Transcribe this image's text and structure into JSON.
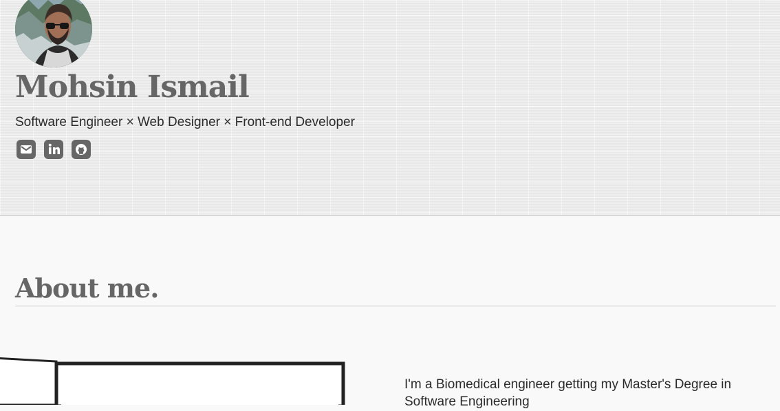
{
  "profile": {
    "name": "Mohsin Ismail",
    "subtitle": "Software Engineer × Web Designer × Front-end Developer",
    "avatar_icon": "profile-photo"
  },
  "social_links": [
    {
      "name": "email",
      "icon": "envelope-icon"
    },
    {
      "name": "linkedin",
      "icon": "linkedin-icon"
    },
    {
      "name": "github",
      "icon": "github-icon"
    }
  ],
  "about": {
    "title": "About me.",
    "text": "I'm a Biomedical engineer getting my Master's Degree in Software Engineering"
  },
  "colors": {
    "heading": "#666666",
    "text": "#2b2b2b",
    "background": "#f9f9f9"
  }
}
